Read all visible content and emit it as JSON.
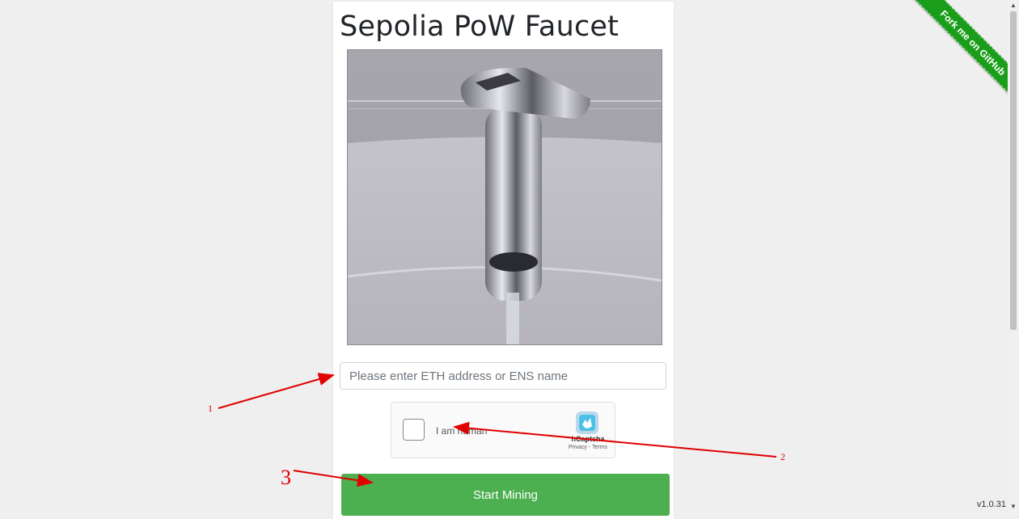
{
  "page": {
    "title": "Sepolia PoW Faucet",
    "version": "v1.0.31"
  },
  "faucet_image": {
    "alt": "faucet"
  },
  "form": {
    "address_placeholder": "Please enter ETH address or ENS name",
    "address_value": "",
    "start_button": "Start Mining"
  },
  "captcha": {
    "checkbox_label": "I am human",
    "brand": "hCaptcha",
    "links": "Privacy - Terms",
    "checked": false
  },
  "ribbon": {
    "label": "Fork me on GitHub",
    "color": "#1a9e1a"
  },
  "annotations": {
    "n1": "1",
    "n2": "2",
    "n3": "3",
    "color": "#e00000"
  },
  "colors": {
    "button": "#4caf50",
    "background": "#efefef"
  }
}
